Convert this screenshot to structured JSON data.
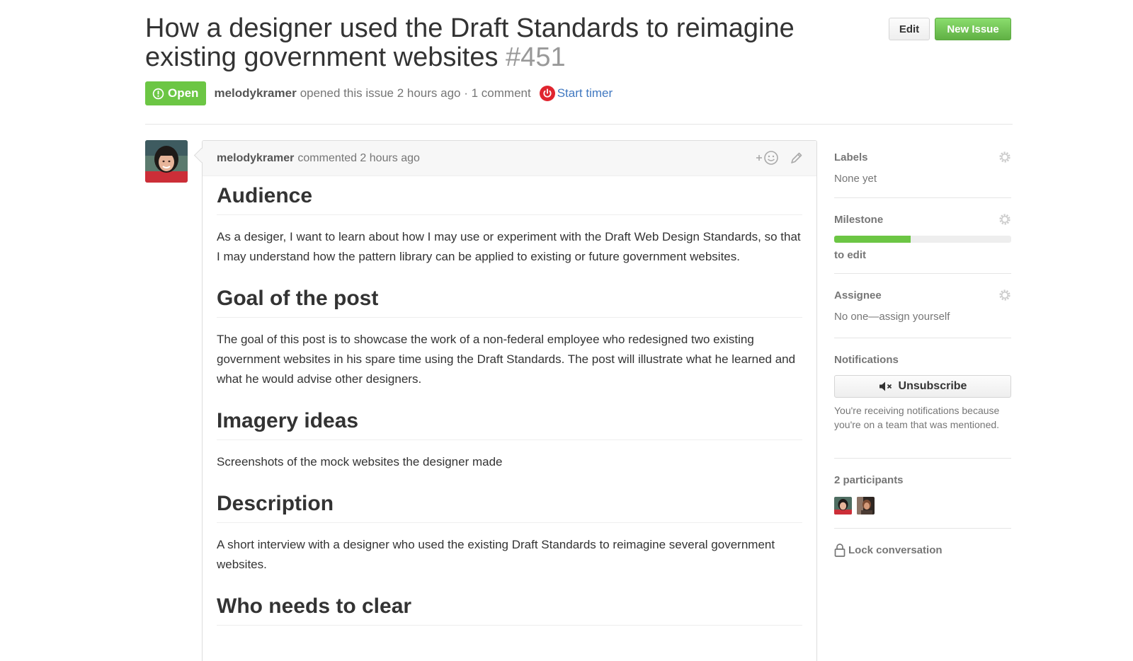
{
  "issue": {
    "title": "How a designer used the Draft Standards to reimagine existing government websites",
    "number": "#451",
    "state": "Open",
    "author": "melodykramer",
    "opened_text": "opened this issue 2 hours ago · 1 comment",
    "timer_label": "Start timer"
  },
  "toolbar": {
    "edit_label": "Edit",
    "new_issue_label": "New Issue"
  },
  "comment": {
    "author": "melodykramer",
    "time_text": "commented 2 hours ago",
    "sections": [
      {
        "heading": "Audience",
        "text": "As a desiger, I want to learn about how I may use or experiment with the Draft Web Design Standards, so that I may understand how the pattern library can be applied to existing or future government websites."
      },
      {
        "heading": "Goal of the post",
        "text": "The goal of this post is to showcase the work of a non-federal employee who redesigned two existing government websites in his spare time using the Draft Standards. The post will illustrate what he learned and what he would advise other designers."
      },
      {
        "heading": "Imagery ideas",
        "text": "Screenshots of the mock websites the designer made"
      },
      {
        "heading": "Description",
        "text": "A short interview with a designer who used the existing Draft Standards to reimagine several government websites."
      },
      {
        "heading": "Who needs to clear",
        "text": ""
      }
    ]
  },
  "sidebar": {
    "labels": {
      "title": "Labels",
      "value": "None yet"
    },
    "milestone": {
      "title": "Milestone",
      "progress": 0.43,
      "value": "to edit"
    },
    "assignee": {
      "title": "Assignee",
      "value": "No one—assign yourself"
    },
    "notifications": {
      "title": "Notifications",
      "button_label": "Unsubscribe",
      "reason": "You're receiving notifications because you're on a team that was mentioned."
    },
    "participants": {
      "title": "2 participants"
    },
    "lock_label": "Lock conversation"
  },
  "colors": {
    "open_green": "#6cc644",
    "link_blue": "#4078c0",
    "timer_red": "#e0252f"
  },
  "icons": {
    "state": "issue-opened-icon",
    "timer": "power-icon",
    "reaction": "add-reaction-icon",
    "edit": "pencil-icon",
    "settings": "gear-icon",
    "mute": "mute-icon",
    "lock": "lock-icon"
  }
}
